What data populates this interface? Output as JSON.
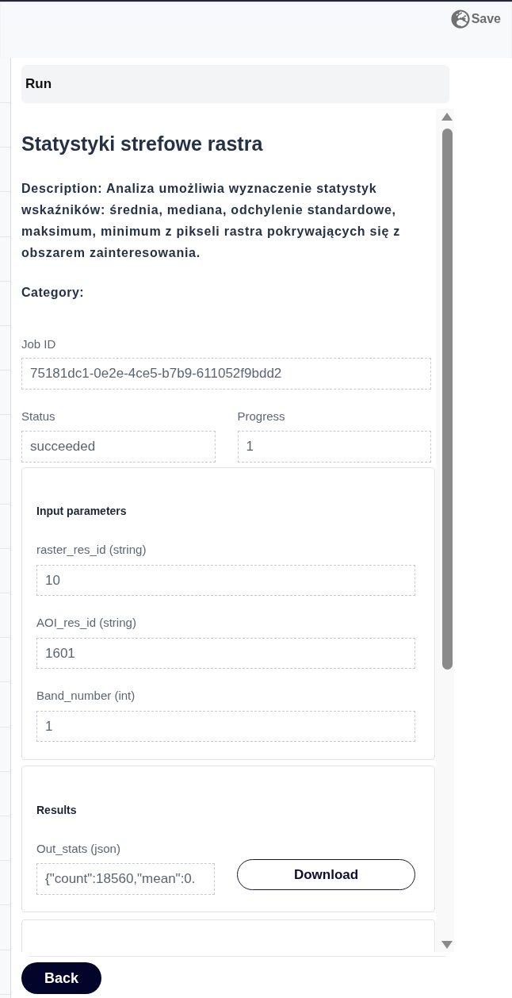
{
  "top_bar": {
    "save_button": {
      "label": "Save"
    }
  },
  "run_panel": {
    "title": "Run"
  },
  "tool": {
    "title": "Statystyki strefowe rastra",
    "description": "Description: Analiza umożliwia wyznaczenie statystyk wskaźników: średnia, mediana, odchylenie standardowe, maksimum, minimum z pikseli rastra pokrywających się z obszarem zainteresowania.",
    "category": "Category:"
  },
  "job": {
    "job_id": {
      "label": "Job ID",
      "value": "75181dc1-0e2e-4ce5-b7b9-611052f9bdd2"
    },
    "status": {
      "label": "Status",
      "value": "succeeded"
    },
    "progress": {
      "label": "Progress",
      "value": "1"
    }
  },
  "input_parameters": {
    "title": "Input parameters",
    "params": [
      {
        "label": "raster_res_id (string)",
        "value": "10"
      },
      {
        "label": "AOI_res_id (string)",
        "value": "1601"
      },
      {
        "label": "Band_number (int)",
        "value": "1"
      }
    ]
  },
  "results": {
    "title": "Results",
    "outputs": [
      {
        "label": "Out_stats (json)",
        "value": "{\"count\":18560,\"mean\":0.",
        "button": "Download"
      }
    ]
  },
  "footer": {
    "back_button": "Back"
  }
}
